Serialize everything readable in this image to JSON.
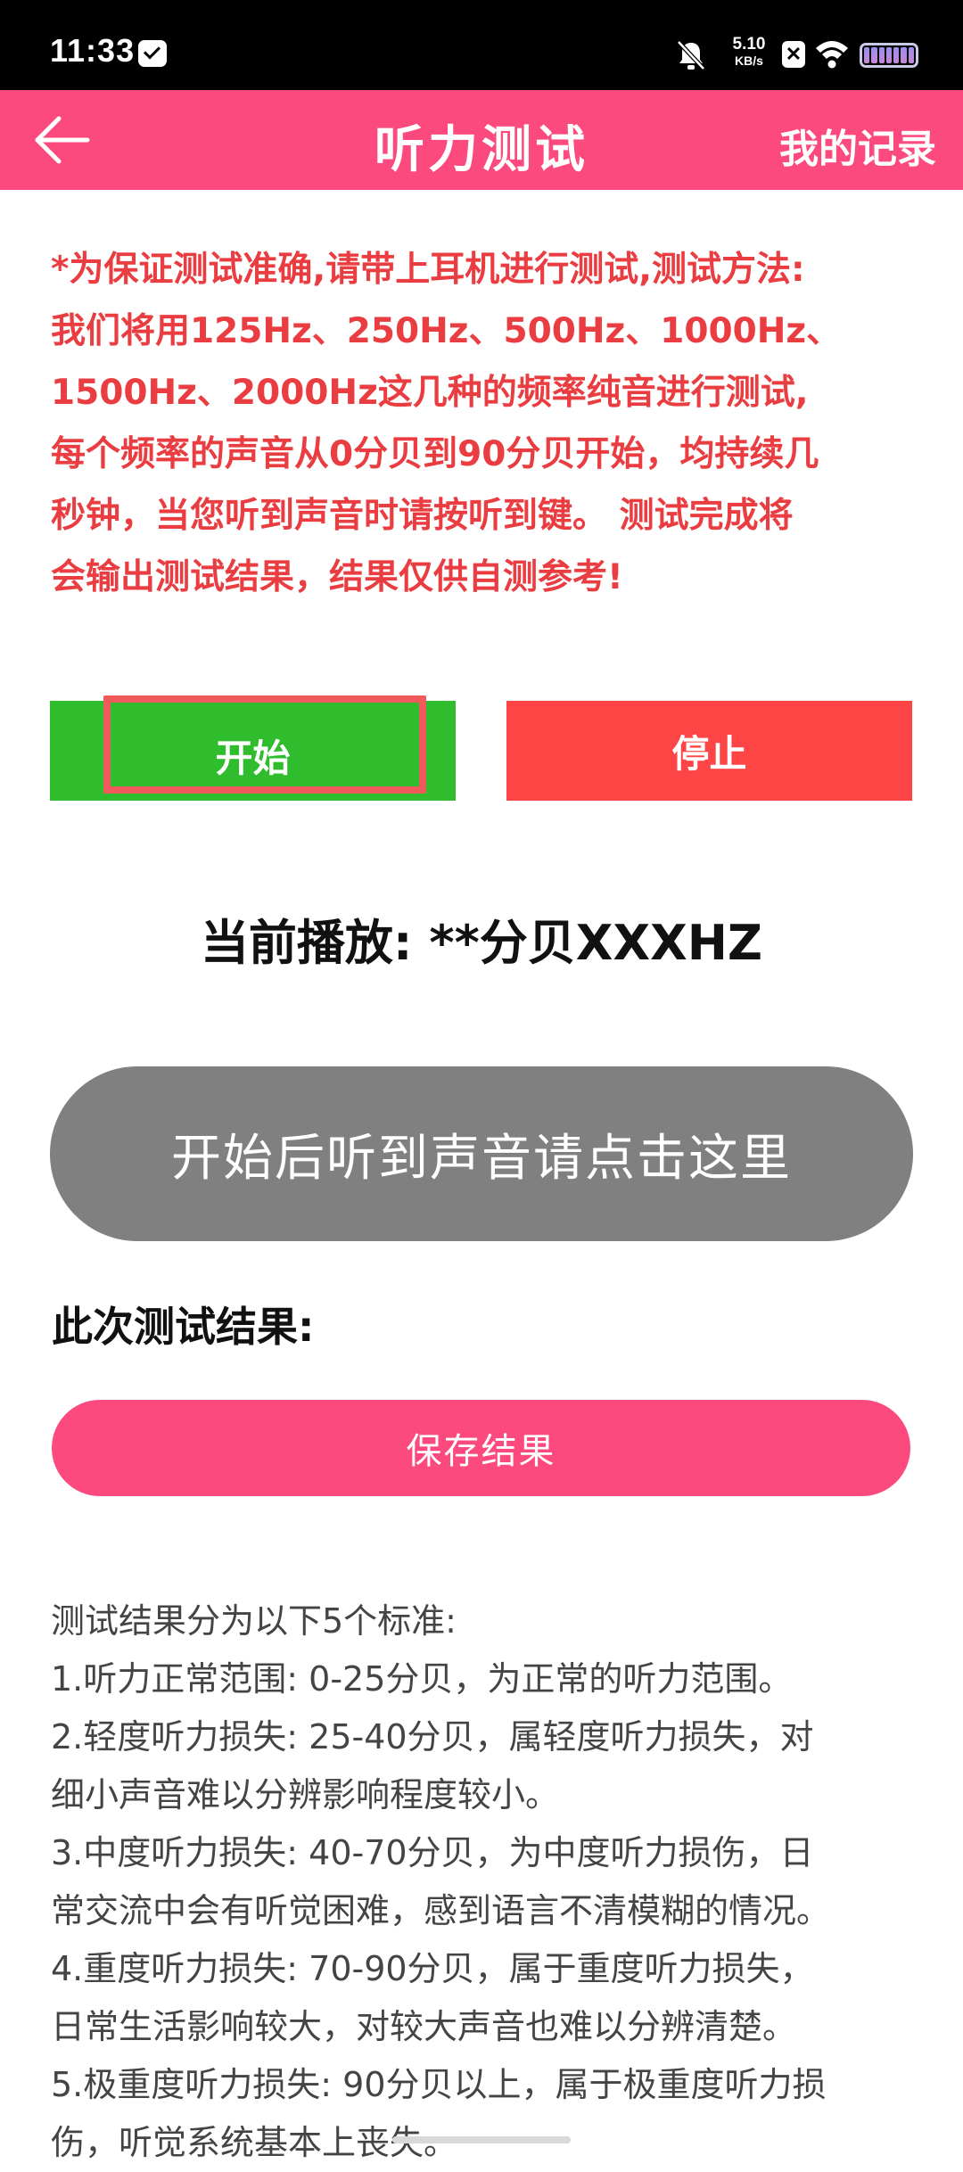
{
  "status_bar": {
    "time": "11:33",
    "net_speed_value": "5.10",
    "net_speed_unit": "KB/s",
    "x_badge": "✕"
  },
  "app_bar": {
    "title": "听力测试",
    "records_label": "我的记录",
    "background": "#fc4a7e"
  },
  "instructions": {
    "text": "*为保证测试准确,请带上耳机进行测试,测试方法:\n 我们将用125Hz、250Hz、500Hz、1000Hz、\n1500Hz、2000Hz这几种的频率纯音进行测试,\n每个频率的声音从0分贝到90分贝开始，均持续几\n秒钟，当您听到声音时请按听到键。 测试完成将\n会输出测试结果，结果仅供自测参考!",
    "color": "#ea3d41"
  },
  "controls": {
    "start_label": "开始",
    "stop_label": "停止",
    "start_color": "#2fbd2e",
    "stop_color": "#fd4545"
  },
  "now_playing": "当前播放: **分贝XXXHZ",
  "hear_button_label": "开始后听到声音请点击这里",
  "result_heading": "此次测试结果:",
  "save_label": "保存结果",
  "standards": [
    "测试结果分为以下5个标准:",
    " 1.听力正常范围: 0-25分贝，为正常的听力范围。",
    " 2.轻度听力损失: 25-40分贝，属轻度听力损失，对",
    "细小声音难以分辨影响程度较小。",
    " 3.中度听力损失: 40-70分贝，为中度听力损伤，日",
    "常交流中会有听觉困难，感到语言不清模糊的情况。",
    " 4.重度听力损失: 70-90分贝，属于重度听力损失，",
    "日常生活影响较大，对较大声音也难以分辨清楚。",
    " 5.极重度听力损失: 90分贝以上，属于极重度听力损",
    "伤，听觉系统基本上丧失。"
  ]
}
